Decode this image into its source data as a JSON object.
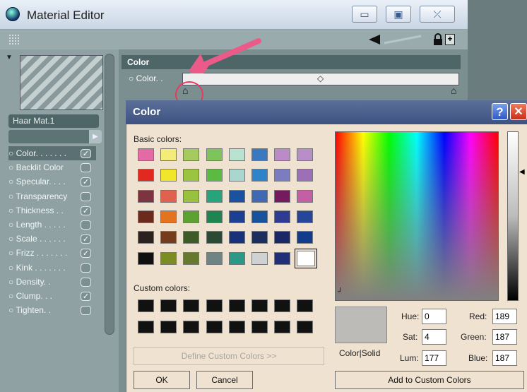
{
  "editor": {
    "title": "Material Editor",
    "material_name": "Haar Mat.1",
    "section_label": "Color",
    "color_row_label": "Color. .",
    "properties": [
      {
        "label": "Color. . . . . . .",
        "checked": true
      },
      {
        "label": "Backlit Color",
        "checked": false
      },
      {
        "label": "Specular. . . .",
        "checked": true
      },
      {
        "label": "Transparency",
        "checked": false
      },
      {
        "label": "Thickness . .",
        "checked": true
      },
      {
        "label": "Length . . . . .",
        "checked": false
      },
      {
        "label": "Scale . . . . . .",
        "checked": true
      },
      {
        "label": "Frizz . . . . . . .",
        "checked": true
      },
      {
        "label": "Kink . . . . . . .",
        "checked": false
      },
      {
        "label": "Density. .",
        "checked": false
      },
      {
        "label": "Clump. . .",
        "checked": true
      },
      {
        "label": "Tighten. .",
        "checked": false
      }
    ],
    "window_buttons": {
      "minimize": "▭",
      "maximize": "▣",
      "close": "⤫"
    }
  },
  "dialog": {
    "title": "Color",
    "help_label": "?",
    "close_label": "✕",
    "basic_label": "Basic colors:",
    "custom_label": "Custom colors:",
    "basic_colors": [
      [
        "#e46aa6",
        "#f3ec7a",
        "#a5cb5e",
        "#7dc45b",
        "#b9e3d0",
        "#3a78bf",
        "#bb8bc5",
        "#b98ec7"
      ],
      [
        "#e1291f",
        "#f1e62a",
        "#9bc541",
        "#5aba42",
        "#a9d6cf",
        "#2f83c9",
        "#7c7cc1",
        "#9c6fb7"
      ],
      [
        "#7c3441",
        "#e0614e",
        "#98c13f",
        "#28a47b",
        "#1a51a0",
        "#3f69b3",
        "#741b60",
        "#c35fa4"
      ],
      [
        "#6b2a1c",
        "#e4721f",
        "#5ea133",
        "#1e8450",
        "#1c3f93",
        "#17529c",
        "#2f3a92",
        "#26469a"
      ],
      [
        "#2b211e",
        "#743b1d",
        "#3d5b27",
        "#2a4a33",
        "#15327a",
        "#1b2e5d",
        "#1c2866",
        "#113c8c"
      ],
      [
        "#101010",
        "#7c8c24",
        "#67792f",
        "#6f8584",
        "#2b9986",
        "#cfd1d2",
        "#1f2f78",
        "#ffffff"
      ]
    ],
    "custom_colors": [
      [
        "#111111",
        "#111111",
        "#111111",
        "#111111",
        "#111111",
        "#111111",
        "#111111",
        "#111111"
      ],
      [
        "#111111",
        "#111111",
        "#111111",
        "#111111",
        "#111111",
        "#111111",
        "#111111",
        "#111111"
      ]
    ],
    "define_button": "Define Custom Colors >>",
    "ok_button": "OK",
    "cancel_button": "Cancel",
    "add_button": "Add to Custom Colors",
    "preview_label": "Color|Solid",
    "preview_color": "#bdbbb8",
    "fields": {
      "hue_label": "Hue:",
      "hue": "0",
      "sat_label": "Sat:",
      "sat": "4",
      "lum_label": "Lum:",
      "lum": "177",
      "red_label": "Red:",
      "red": "189",
      "green_label": "Green:",
      "green": "187",
      "blue_label": "Blue:",
      "blue": "187"
    }
  },
  "colors": {
    "accent_red": "#e83a5c",
    "title_blue": "#4a5e8e"
  }
}
